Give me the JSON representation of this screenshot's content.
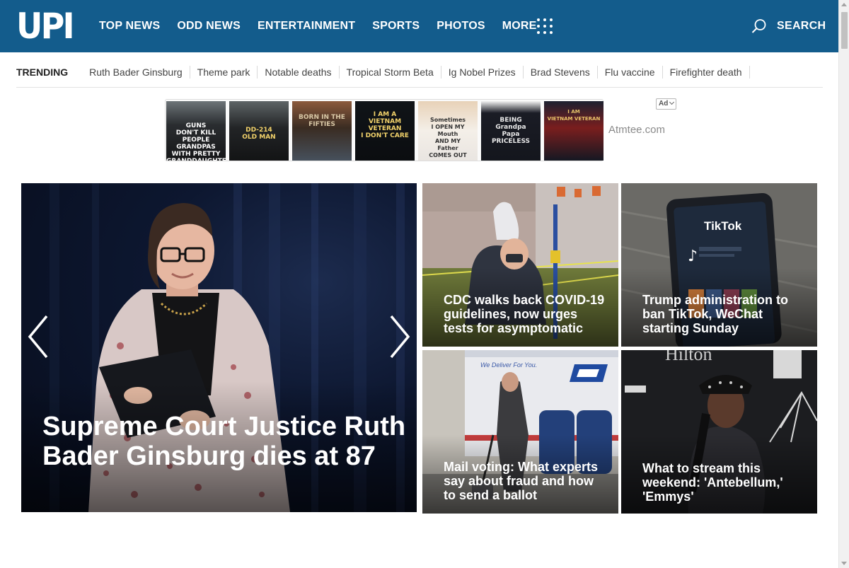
{
  "header": {
    "logo": "UPI",
    "nav": [
      "TOP NEWS",
      "ODD NEWS",
      "ENTERTAINMENT",
      "SPORTS",
      "PHOTOS",
      "MORE"
    ],
    "search_label": "SEARCH",
    "background_color": "#135c8c"
  },
  "trending": {
    "label": "TRENDING",
    "items": [
      "Ruth Bader Ginsburg",
      "Theme park",
      "Notable deaths",
      "Tropical Storm Beta",
      "Ig Nobel Prizes",
      "Brad Stevens",
      "Flu vaccine",
      "Firefighter death"
    ]
  },
  "ad": {
    "badge": "Ad",
    "source": "Atmtee.com",
    "shirts": [
      {
        "text": "GUNS\nDON'T KILL PEOPLE\nGRANDPAS\nWITH PRETTY\nGRANDDAUGHTERS DO"
      },
      {
        "text": "DD-214\nOLD MAN"
      },
      {
        "text": "BORN IN THE\nFIFTIES"
      },
      {
        "text": "I AM A\nVIETNAM\nVETERAN\nI DON'T CARE"
      },
      {
        "text": "Sometimes\nI OPEN MY\nMouth\nAND MY\nFather\nCOMES OUT"
      },
      {
        "text": "BEING\nGrandpa\nPapa\nPRICELESS"
      },
      {
        "text": "I AM\nVIETNAM VETERAN"
      }
    ]
  },
  "hero": {
    "headline": "Supreme Court Justice Ruth Bader Ginsburg dies at 87"
  },
  "tiles": [
    {
      "headline": "CDC walks back COVID-19 guidelines, now urges tests for asymptomatic"
    },
    {
      "headline": "Trump administration to ban TikTok, WeChat starting Sunday",
      "screen_text": "TikTok"
    },
    {
      "headline": "Mail voting: What experts say about fraud and how to send a ballot",
      "truck_text": "We Deliver For You."
    },
    {
      "headline": "What to stream this weekend: 'Antebellum,' 'Emmys'",
      "backdrop_text": "Hilton"
    }
  ]
}
